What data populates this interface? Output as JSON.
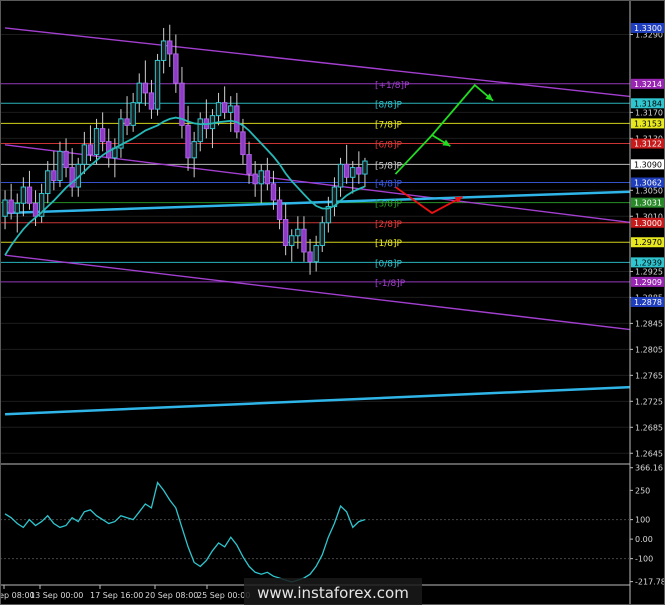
{
  "chart_data": {
    "type": "line",
    "price_axis": {
      "ticks": [
        "1.3290",
        "1.3170",
        "1.3130",
        "1.3050",
        "1.3010",
        "1.2925",
        "1.2885",
        "1.2845",
        "1.2805",
        "1.2765",
        "1.2725",
        "1.2685",
        "1.2645"
      ],
      "range": [
        1.263,
        1.334
      ]
    },
    "price_markers": [
      {
        "value": 1.33,
        "text": "1.3300",
        "color": "#1f3ebd"
      },
      {
        "value": 1.3214,
        "text": "1.3214",
        "color": "#9a27b4"
      },
      {
        "value": 1.3184,
        "text": "1.3184",
        "color": "#2fc6d0"
      },
      {
        "value": 1.3153,
        "text": "1.3153",
        "color": "#e8e820"
      },
      {
        "value": 1.3122,
        "text": "1.3122",
        "color": "#c81b1b"
      },
      {
        "value": 1.309,
        "text": "1.3090",
        "color": "#ffffff"
      },
      {
        "value": 1.3062,
        "text": "1.3062",
        "color": "#1f3ebd"
      },
      {
        "value": 1.3031,
        "text": "1.3031",
        "color": "#2a8a2a"
      },
      {
        "value": 1.3,
        "text": "1.3000",
        "color": "#c81b1b"
      },
      {
        "value": 1.297,
        "text": "1.2970",
        "color": "#e8e820"
      },
      {
        "value": 1.2939,
        "text": "1.2939",
        "color": "#2fc6d0"
      },
      {
        "value": 1.2909,
        "text": "1.2909",
        "color": "#9a27b4"
      },
      {
        "value": 1.2878,
        "text": "1.2878",
        "color": "#1f3ebd"
      }
    ],
    "murrey_levels": [
      {
        "label": "[+1/8]P",
        "value": 1.3214,
        "color": "#a33fd0"
      },
      {
        "label": "[8/8]P",
        "value": 1.3184,
        "color": "#2fc6d0"
      },
      {
        "label": "[7/8]P",
        "value": 1.3153,
        "color": "#e8e820"
      },
      {
        "label": "[6/8]P",
        "value": 1.3122,
        "color": "#e23a3a"
      },
      {
        "label": "[5/8]P",
        "value": 1.309,
        "color": "#cfcfcf"
      },
      {
        "label": "[4/8]P",
        "value": 1.3062,
        "color": "#3a5ae0"
      },
      {
        "label": "[3/8]P",
        "value": 1.3031,
        "color": "#2aa02a"
      },
      {
        "label": "[2/8]P",
        "value": 1.3,
        "color": "#e23a3a"
      },
      {
        "label": "[1/8]P",
        "value": 1.297,
        "color": "#e8e820"
      },
      {
        "label": "[0/8]P",
        "value": 1.2939,
        "color": "#2fc6d0"
      },
      {
        "label": "[-1/8]P",
        "value": 1.2909,
        "color": "#a33fd0"
      }
    ],
    "time_axis": [
      "Sep 08:00",
      "13 Sep 00:00",
      "17 Sep 16:00",
      "20 Sep 08:00",
      "25 Sep 00:00"
    ],
    "candles": [
      [
        1.301,
        1.305,
        1.299,
        1.3035
      ],
      [
        1.3035,
        1.306,
        1.3005,
        1.3015
      ],
      [
        1.3015,
        1.3045,
        1.2985,
        1.303
      ],
      [
        1.303,
        1.307,
        1.301,
        1.3055
      ],
      [
        1.3055,
        1.308,
        1.302,
        1.303
      ],
      [
        1.303,
        1.305,
        1.2995,
        1.301
      ],
      [
        1.301,
        1.306,
        1.3,
        1.3045
      ],
      [
        1.3045,
        1.3095,
        1.303,
        1.308
      ],
      [
        1.308,
        1.311,
        1.305,
        1.3065
      ],
      [
        1.3065,
        1.3125,
        1.3055,
        1.311
      ],
      [
        1.311,
        1.313,
        1.307,
        1.3085
      ],
      [
        1.3085,
        1.3115,
        1.304,
        1.3055
      ],
      [
        1.3055,
        1.31,
        1.304,
        1.309
      ],
      [
        1.309,
        1.314,
        1.3075,
        1.312
      ],
      [
        1.312,
        1.315,
        1.3095,
        1.3105
      ],
      [
        1.3105,
        1.316,
        1.309,
        1.3145
      ],
      [
        1.3145,
        1.317,
        1.311,
        1.3125
      ],
      [
        1.3125,
        1.3145,
        1.3085,
        1.31
      ],
      [
        1.31,
        1.313,
        1.307,
        1.3115
      ],
      [
        1.3115,
        1.3175,
        1.31,
        1.316
      ],
      [
        1.316,
        1.3195,
        1.3135,
        1.315
      ],
      [
        1.315,
        1.32,
        1.314,
        1.3185
      ],
      [
        1.3185,
        1.323,
        1.317,
        1.3215
      ],
      [
        1.3215,
        1.325,
        1.318,
        1.32
      ],
      [
        1.32,
        1.322,
        1.316,
        1.3175
      ],
      [
        1.3175,
        1.326,
        1.3165,
        1.325
      ],
      [
        1.325,
        1.33,
        1.323,
        1.328
      ],
      [
        1.328,
        1.3305,
        1.324,
        1.326
      ],
      [
        1.326,
        1.329,
        1.32,
        1.3215
      ],
      [
        1.3215,
        1.324,
        1.313,
        1.315
      ],
      [
        1.315,
        1.318,
        1.308,
        1.31
      ],
      [
        1.31,
        1.314,
        1.307,
        1.3125
      ],
      [
        1.3125,
        1.317,
        1.311,
        1.316
      ],
      [
        1.316,
        1.319,
        1.313,
        1.3145
      ],
      [
        1.3145,
        1.3175,
        1.3115,
        1.3165
      ],
      [
        1.3165,
        1.32,
        1.315,
        1.3185
      ],
      [
        1.3185,
        1.321,
        1.316,
        1.317
      ],
      [
        1.317,
        1.3195,
        1.314,
        1.318
      ],
      [
        1.318,
        1.32,
        1.313,
        1.314
      ],
      [
        1.314,
        1.316,
        1.309,
        1.3105
      ],
      [
        1.3105,
        1.3125,
        1.306,
        1.3075
      ],
      [
        1.3075,
        1.3095,
        1.304,
        1.306
      ],
      [
        1.306,
        1.309,
        1.303,
        1.308
      ],
      [
        1.308,
        1.31,
        1.305,
        1.306
      ],
      [
        1.306,
        1.308,
        1.302,
        1.3035
      ],
      [
        1.3035,
        1.3055,
        1.299,
        1.3005
      ],
      [
        1.3005,
        1.303,
        1.295,
        1.2965
      ],
      [
        1.2965,
        1.299,
        1.294,
        1.298
      ],
      [
        1.298,
        1.301,
        1.296,
        1.299
      ],
      [
        1.299,
        1.301,
        1.294,
        1.2955
      ],
      [
        1.2955,
        1.2975,
        1.292,
        1.294
      ],
      [
        1.294,
        1.298,
        1.2925,
        1.2965
      ],
      [
        1.2965,
        1.301,
        1.2955,
        1.3
      ],
      [
        1.3,
        1.304,
        1.2985,
        1.3025
      ],
      [
        1.3025,
        1.307,
        1.301,
        1.3055
      ],
      [
        1.3055,
        1.31,
        1.304,
        1.309
      ],
      [
        1.309,
        1.312,
        1.306,
        1.307
      ],
      [
        1.307,
        1.3095,
        1.3045,
        1.3085
      ],
      [
        1.3085,
        1.311,
        1.306,
        1.3075
      ],
      [
        1.3075,
        1.31,
        1.3055,
        1.3095
      ]
    ],
    "moving_average": [
      1.295,
      1.2965,
      1.2978,
      1.299,
      1.3,
      1.3008,
      1.3016,
      1.3025,
      1.3034,
      1.3044,
      1.3054,
      1.3062,
      1.307,
      1.3079,
      1.3088,
      1.3096,
      1.3104,
      1.311,
      1.3115,
      1.312,
      1.3125,
      1.313,
      1.3136,
      1.3142,
      1.3146,
      1.315,
      1.3156,
      1.316,
      1.3162,
      1.316,
      1.3156,
      1.3153,
      1.3152,
      1.3152,
      1.3153,
      1.3155,
      1.3156,
      1.3157,
      1.3155,
      1.315,
      1.3142,
      1.3132,
      1.3122,
      1.3112,
      1.3102,
      1.309,
      1.3076,
      1.3064,
      1.3054,
      1.3044,
      1.3034,
      1.3026,
      1.3022,
      1.3022,
      1.3026,
      1.3034,
      1.3042,
      1.3048,
      1.3052,
      1.3056
    ],
    "cci": {
      "ticks": [
        "366.161",
        "250",
        "100",
        "0.00",
        "-100",
        "-217.789"
      ],
      "range": [
        -230,
        380
      ],
      "values": [
        130,
        110,
        80,
        60,
        100,
        70,
        90,
        120,
        80,
        60,
        70,
        110,
        90,
        140,
        150,
        120,
        100,
        80,
        90,
        120,
        110,
        100,
        140,
        180,
        160,
        290,
        250,
        200,
        160,
        60,
        -40,
        -120,
        -140,
        -110,
        -60,
        -20,
        -40,
        10,
        -30,
        -90,
        -140,
        -170,
        -180,
        -170,
        -190,
        -200,
        -210,
        -220,
        -210,
        -200,
        -180,
        -140,
        -80,
        10,
        80,
        170,
        140,
        60,
        90,
        100
      ]
    },
    "trend_lines": [
      {
        "from": [
          0,
          1.335
        ],
        "to": [
          71,
          1.336
        ],
        "color": "#2fb5e8"
      },
      {
        "from": [
          0,
          1.33
        ],
        "to": [
          103,
          1.3194
        ],
        "color": "#a33fd0"
      },
      {
        "from": [
          0,
          1.312
        ],
        "to": [
          103,
          1.3
        ],
        "color": "#a33fd0"
      },
      {
        "from": [
          0,
          1.295
        ],
        "to": [
          103,
          1.2835
        ],
        "color": "#a33fd0"
      },
      {
        "from": [
          0,
          1.3015
        ],
        "to": [
          103,
          1.3048
        ],
        "color": "#2fb5e8"
      },
      {
        "from": [
          0,
          1.2705
        ],
        "to": [
          103,
          1.2747
        ],
        "color": "#2fb5e8"
      }
    ],
    "forecast_arrows": [
      {
        "points": [
          [
            64,
            1.3075
          ],
          [
            70,
            1.3135
          ],
          [
            73,
            1.3118
          ]
        ],
        "color": "#22dd22"
      },
      {
        "points": [
          [
            70,
            1.3135
          ],
          [
            77,
            1.3212
          ],
          [
            80,
            1.3188
          ]
        ],
        "color": "#22dd22"
      },
      {
        "points": [
          [
            64,
            1.3055
          ],
          [
            70,
            1.3015
          ],
          [
            75,
            1.304
          ]
        ],
        "color": "#ee1111"
      }
    ]
  },
  "watermark": "www.instaforex.com"
}
